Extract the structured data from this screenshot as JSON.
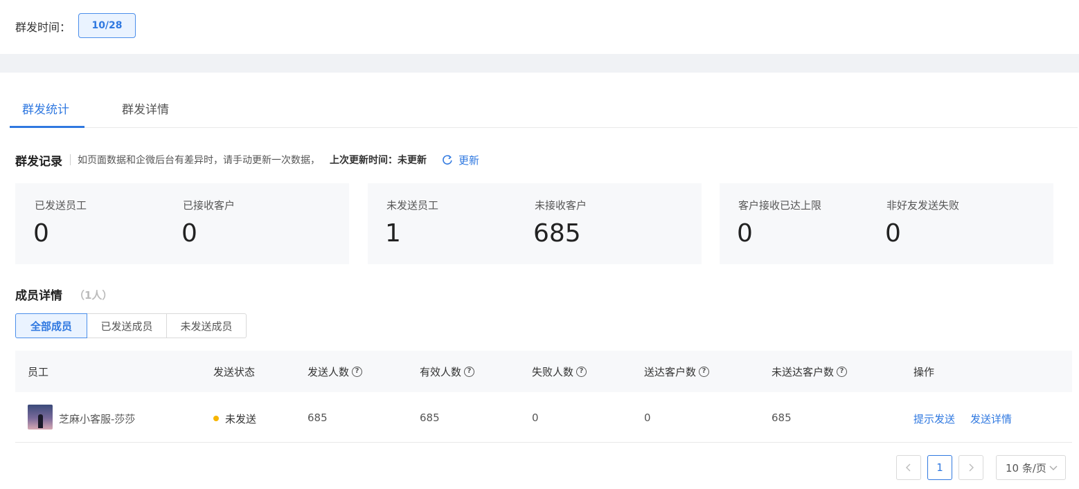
{
  "header": {
    "send_time_label": "群发时间：",
    "date": "10/28"
  },
  "tabs": [
    {
      "label": "群发统计",
      "active": true
    },
    {
      "label": "群发详情",
      "active": false
    }
  ],
  "record": {
    "title": "群发记录",
    "description": "如页面数据和企微后台有差异时，请手动更新一次数据，",
    "last_update": "上次更新时间：未更新",
    "refresh_label": "更新",
    "refresh_icon": "refresh-icon"
  },
  "stats": [
    {
      "label": "已发送员工",
      "value": "0"
    },
    {
      "label": "已接收客户",
      "value": "0"
    },
    {
      "label": "未发送员工",
      "value": "1"
    },
    {
      "label": "未接收客户",
      "value": "685"
    },
    {
      "label": "客户接收已达上限",
      "value": "0"
    },
    {
      "label": "非好友发送失败",
      "value": "0"
    }
  ],
  "members": {
    "title": "成员详情",
    "count": "（1人）",
    "filters": [
      "全部成员",
      "已发送成员",
      "未发送成员"
    ],
    "active_filter": "全部成员"
  },
  "table": {
    "columns": [
      "员工",
      "发送状态",
      "发送人数",
      "有效人数",
      "失败人数",
      "送达客户数",
      "未送达客户数",
      "操作"
    ],
    "help_icon": "?",
    "rows": [
      {
        "employee": "芝麻小客服-莎莎",
        "status": "未发送",
        "sent": "685",
        "valid": "685",
        "failed": "0",
        "delivered": "0",
        "undelivered": "685",
        "actions": [
          "提示发送",
          "发送详情"
        ]
      }
    ]
  },
  "pagination": {
    "current": "1",
    "page_size": "10 条/页"
  },
  "colors": {
    "primary": "#2f78e0",
    "status_pending": "#f7b500",
    "card_bg": "#f7f8fa"
  }
}
